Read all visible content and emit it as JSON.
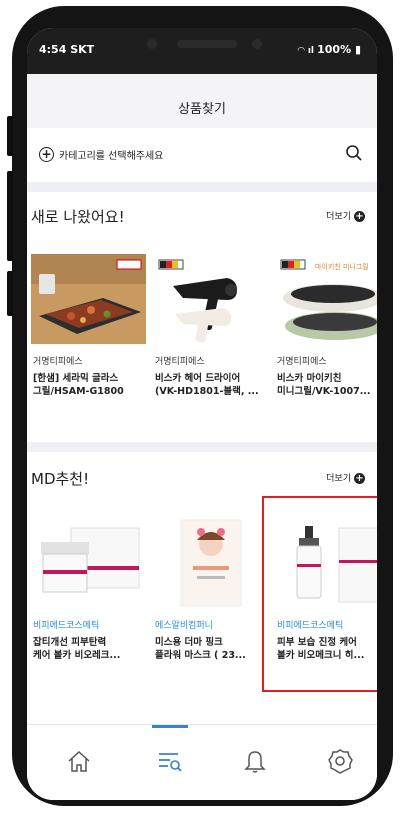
{
  "status_bar": {
    "time": "4:54",
    "carrier": "SKT",
    "battery": "100%"
  },
  "header": {
    "title": "상품찾기"
  },
  "category": {
    "placeholder": "카테고리를 선택해주세요"
  },
  "new_section": {
    "title": "새로 나왔어요!",
    "more_label": "더보기",
    "items": [
      {
        "brand": "거명티피에스",
        "name_line1": "[한샘] 세라믹 글라스",
        "name_line2": "그릴/HSAM-G1800"
      },
      {
        "brand": "거명티피에스",
        "name_line1": "비스카 헤어 드라이어",
        "name_line2": "(VK-HD1801-블랙, ..."
      },
      {
        "brand": "거명티피에스",
        "name_line1": "비스카 마이키친",
        "name_line2": "미니그릴/VK-1007..."
      }
    ]
  },
  "md_section": {
    "title": "MD추천!",
    "more_label": "더보기",
    "items": [
      {
        "brand": "비피에드코스메틱",
        "name_line1": "잡티개선 피부탄력",
        "name_line2": "케어 볼카 비오레크..."
      },
      {
        "brand": "에스알비컴퍼니",
        "name_line1": "미스용 더마 핑크",
        "name_line2": "플라워 마스크 ( 23..."
      },
      {
        "brand": "비피에드코스메틱",
        "name_line1": "피부 보습 진정 케어",
        "name_line2": "볼카 비오메크니 히..."
      }
    ]
  },
  "product_image_labels": {
    "germany_badge": "",
    "mini_grill_tag": "마이키친 미니그릴",
    "cosmetic_brand": "BoLCA"
  },
  "bottom_nav": [
    "home-icon",
    "search-list-icon",
    "bell-icon",
    "settings-icon"
  ],
  "colors": {
    "accent": "#3a7fd9",
    "brand_blue": "#2a8ddc",
    "highlight": "#e02020",
    "band": "#eef0f3"
  }
}
